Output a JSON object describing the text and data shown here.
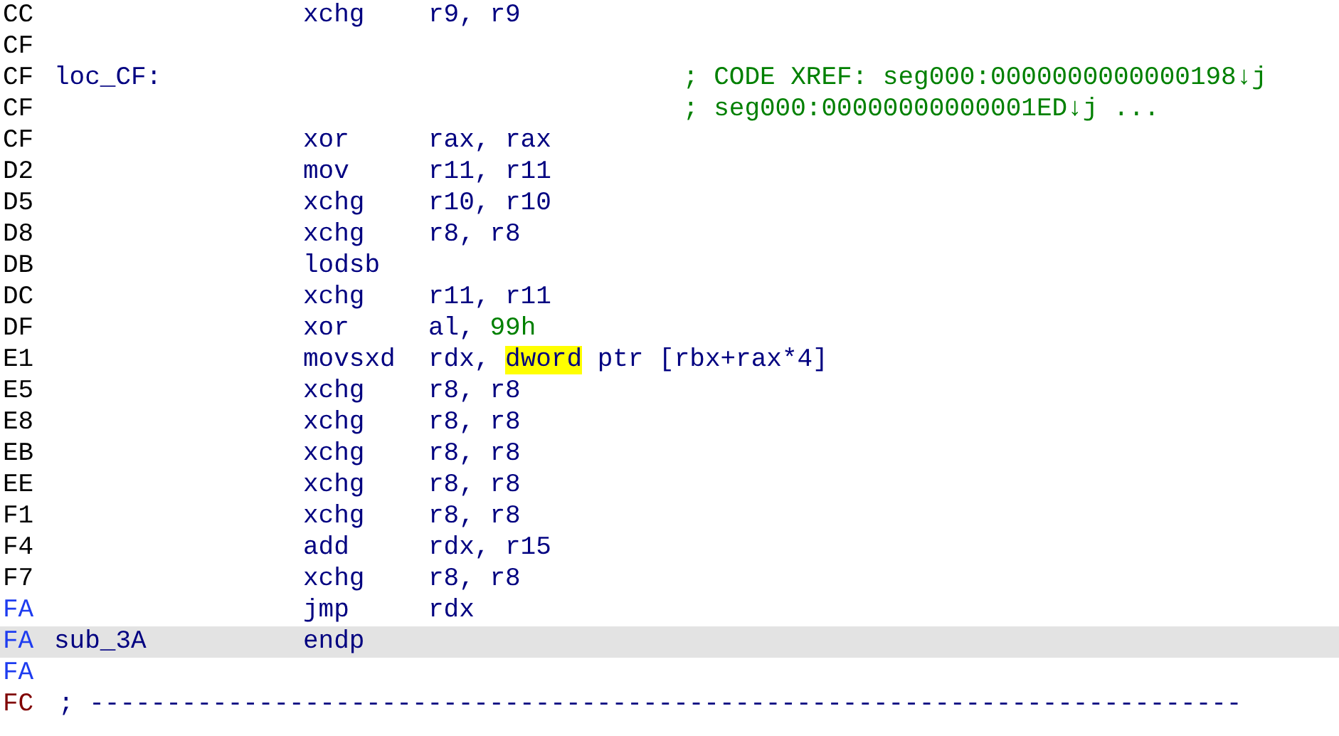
{
  "lines": [
    {
      "address": "CC",
      "kind": "normal",
      "selected": false,
      "mnemonic": "xchg",
      "operands": [
        {
          "text": "r9, r9",
          "kind": "plain"
        }
      ]
    },
    {
      "address": "CF",
      "kind": "normal",
      "selected": false
    },
    {
      "address": "CF",
      "kind": "normal",
      "selected": false,
      "label": "loc_CF:",
      "comment": "; CODE XREF: seg000:0000000000000198↓j"
    },
    {
      "address": "CF",
      "kind": "normal",
      "selected": false,
      "comment": "; seg000:00000000000001ED↓j ..."
    },
    {
      "address": "CF",
      "kind": "normal",
      "selected": false,
      "mnemonic": "xor",
      "operands": [
        {
          "text": "rax, rax",
          "kind": "plain"
        }
      ]
    },
    {
      "address": "D2",
      "kind": "normal",
      "selected": false,
      "mnemonic": "mov",
      "operands": [
        {
          "text": "r11, r11",
          "kind": "plain"
        }
      ]
    },
    {
      "address": "D5",
      "kind": "normal",
      "selected": false,
      "mnemonic": "xchg",
      "operands": [
        {
          "text": "r10, r10",
          "kind": "plain"
        }
      ]
    },
    {
      "address": "D8",
      "kind": "normal",
      "selected": false,
      "mnemonic": "xchg",
      "operands": [
        {
          "text": "r8, r8",
          "kind": "plain"
        }
      ]
    },
    {
      "address": "DB",
      "kind": "normal",
      "selected": false,
      "mnemonic": "lodsb"
    },
    {
      "address": "DC",
      "kind": "normal",
      "selected": false,
      "mnemonic": "xchg",
      "operands": [
        {
          "text": "r11, r11",
          "kind": "plain"
        }
      ]
    },
    {
      "address": "DF",
      "kind": "normal",
      "selected": false,
      "mnemonic": "xor",
      "operands": [
        {
          "text": "al, ",
          "kind": "plain"
        },
        {
          "text": "99h",
          "kind": "number"
        }
      ]
    },
    {
      "address": "E1",
      "kind": "normal",
      "selected": false,
      "mnemonic": "movsxd",
      "operands": [
        {
          "text": "rdx, ",
          "kind": "plain"
        },
        {
          "text": "dword",
          "kind": "highlight"
        },
        {
          "text": " ptr [rbx+rax*4]",
          "kind": "plain"
        }
      ]
    },
    {
      "address": "E5",
      "kind": "normal",
      "selected": false,
      "mnemonic": "xchg",
      "operands": [
        {
          "text": "r8, r8",
          "kind": "plain"
        }
      ]
    },
    {
      "address": "E8",
      "kind": "normal",
      "selected": false,
      "mnemonic": "xchg",
      "operands": [
        {
          "text": "r8, r8",
          "kind": "plain"
        }
      ]
    },
    {
      "address": "EB",
      "kind": "normal",
      "selected": false,
      "mnemonic": "xchg",
      "operands": [
        {
          "text": "r8, r8",
          "kind": "plain"
        }
      ]
    },
    {
      "address": "EE",
      "kind": "normal",
      "selected": false,
      "mnemonic": "xchg",
      "operands": [
        {
          "text": "r8, r8",
          "kind": "plain"
        }
      ]
    },
    {
      "address": "F1",
      "kind": "normal",
      "selected": false,
      "mnemonic": "xchg",
      "operands": [
        {
          "text": "r8, r8",
          "kind": "plain"
        }
      ]
    },
    {
      "address": "F4",
      "kind": "normal",
      "selected": false,
      "mnemonic": "add",
      "operands": [
        {
          "text": "rdx, r15",
          "kind": "plain"
        }
      ]
    },
    {
      "address": "F7",
      "kind": "normal",
      "selected": false,
      "mnemonic": "xchg",
      "operands": [
        {
          "text": "r8, r8",
          "kind": "plain"
        }
      ]
    },
    {
      "address": "FA",
      "kind": "end",
      "selected": false,
      "mnemonic": "jmp",
      "operands": [
        {
          "text": "rdx",
          "kind": "plain"
        }
      ]
    },
    {
      "address": "FA",
      "kind": "end",
      "selected": true,
      "label": "sub_3A",
      "mnemonic": "endp"
    },
    {
      "address": "FA",
      "kind": "end",
      "selected": false
    },
    {
      "address": "FC",
      "kind": "data",
      "selected": false,
      "separator": "; ---------------------------------------------------------------------------"
    }
  ]
}
